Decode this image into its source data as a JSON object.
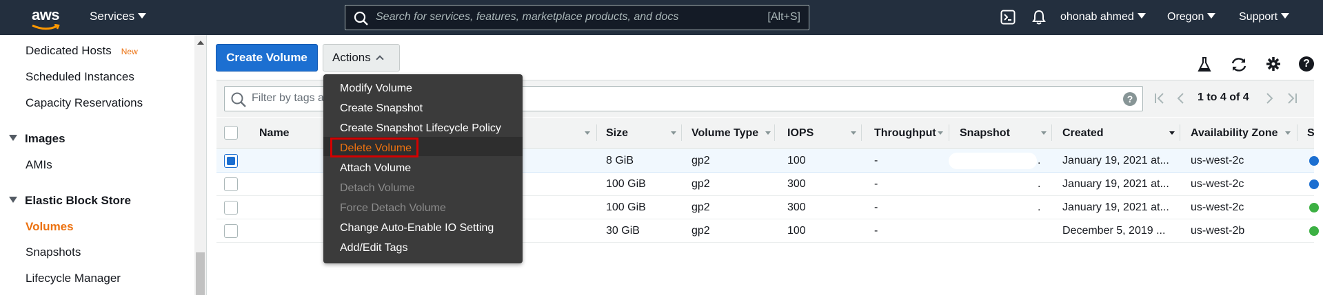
{
  "topnav": {
    "logo_text": "aws",
    "services_label": "Services",
    "search_placeholder": "Search for services, features, marketplace products, and docs",
    "search_shortcut": "[Alt+S]",
    "user": "ohonab ahmed",
    "region": "Oregon",
    "support": "Support"
  },
  "sidebar": {
    "dedicated_hosts": "Dedicated Hosts",
    "new_badge": "New",
    "scheduled_instances": "Scheduled Instances",
    "capacity_reservations": "Capacity Reservations",
    "images_header": "Images",
    "amis": "AMIs",
    "ebs_header": "Elastic Block Store",
    "volumes": "Volumes",
    "snapshots": "Snapshots",
    "lifecycle_manager": "Lifecycle Manager"
  },
  "toolbar": {
    "create_volume": "Create Volume",
    "actions": "Actions"
  },
  "filter": {
    "placeholder": "Filter by tags a",
    "help": "?",
    "pagination": "1 to 4 of 4"
  },
  "table": {
    "headers": [
      "Name",
      "Size",
      "Volume Type",
      "IOPS",
      "Throughput",
      "Snapshot",
      "Created",
      "Availability Zone",
      "S"
    ],
    "rows": [
      {
        "size": "8 GiB",
        "type": "gp2",
        "iops": "100",
        "throughput": "-",
        "snapshot": ".",
        "created": "January 19, 2021 at...",
        "az": "us-west-2c",
        "state_color": "#1c6fd1",
        "selected": true
      },
      {
        "size": "100 GiB",
        "type": "gp2",
        "iops": "300",
        "throughput": "-",
        "snapshot": ".",
        "created": "January 19, 2021 at...",
        "az": "us-west-2c",
        "state_color": "#1c6fd1",
        "selected": false
      },
      {
        "size": "100 GiB",
        "type": "gp2",
        "iops": "300",
        "throughput": "-",
        "snapshot": ".",
        "created": "January 19, 2021 at...",
        "az": "us-west-2c",
        "state_color": "#3cb043",
        "selected": false
      },
      {
        "size": "30 GiB",
        "type": "gp2",
        "iops": "100",
        "throughput": "-",
        "snapshot": "",
        "created": "December 5, 2019 ...",
        "az": "us-west-2b",
        "state_color": "#3cb043",
        "selected": false
      }
    ]
  },
  "actions_menu": {
    "items": [
      {
        "label": "Modify Volume",
        "state": "enabled"
      },
      {
        "label": "Create Snapshot",
        "state": "enabled"
      },
      {
        "label": "Create Snapshot Lifecycle Policy",
        "state": "enabled"
      },
      {
        "label": "Delete Volume",
        "state": "highlighted"
      },
      {
        "label": "Attach Volume",
        "state": "enabled"
      },
      {
        "label": "Detach Volume",
        "state": "disabled"
      },
      {
        "label": "Force Detach Volume",
        "state": "disabled"
      },
      {
        "label": "Change Auto-Enable IO Setting",
        "state": "enabled"
      },
      {
        "label": "Add/Edit Tags",
        "state": "enabled"
      }
    ]
  },
  "colors": {
    "nav_bg": "#232f3e",
    "accent_orange": "#ec7211",
    "primary_blue": "#1c6fd1",
    "menu_bg": "#3b3b3b",
    "highlight_box": "#d40000"
  }
}
